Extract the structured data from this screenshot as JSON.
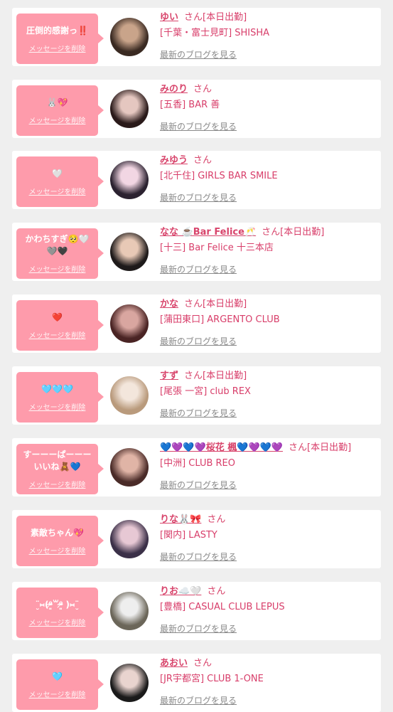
{
  "delete_label": "メッセージを削除",
  "blog_label": "最新のブログを見る",
  "honorific": "さん",
  "items": [
    {
      "message": "圧倒的感謝っ‼️",
      "name": "ゆい",
      "status": "[本日出勤]",
      "shop": "[千葉・富士見町] SHISHA",
      "avatar_colors": [
        "#3a2a22",
        "#c9a48a"
      ]
    },
    {
      "message": "🐰💖",
      "name": "みのり",
      "status": "",
      "shop": "[五香] BAR 善",
      "avatar_colors": [
        "#2a1a1a",
        "#e5c7c0"
      ]
    },
    {
      "message": "🤍",
      "name": "みゆう",
      "status": "",
      "shop": "[北千住] GIRLS BAR SMILE",
      "avatar_colors": [
        "#2b2230",
        "#f2d6e3"
      ]
    },
    {
      "message": "かわちすぎ🥺🤍🩶🖤",
      "name": "なな ☕️Bar Felice🥂",
      "status": "[本日出勤]",
      "shop": "[十三] Bar Felice 十三本店",
      "avatar_colors": [
        "#1e1a1a",
        "#e8c9b6"
      ]
    },
    {
      "message": "❤️",
      "name": "かな",
      "status": "[本日出勤]",
      "shop": "[蒲田東口] ARGENTO CLUB",
      "avatar_colors": [
        "#4a2424",
        "#d9a6a0"
      ]
    },
    {
      "message": "🩵🩵🩵",
      "name": "すず",
      "status": "[本日出勤]",
      "shop": "[尾張 一宮] club REX",
      "avatar_colors": [
        "#b99a7c",
        "#f3e6dc"
      ]
    },
    {
      "message": "すーーーぱーーーいいね🧸💙",
      "name": "💙💜💙💜桜花 楓💙💜💙💜",
      "status": "[本日出勤]",
      "shop": "[中洲] CLUB REO",
      "avatar_colors": [
        "#4a2b28",
        "#e0b4a6"
      ]
    },
    {
      "message": "素敵ちゃん💖",
      "name": "りな🐰🎀",
      "status": "",
      "shop": "[関内] LASTY",
      "avatar_colors": [
        "#3b3048",
        "#e7c8d4"
      ]
    },
    {
      "message": "¨̮⑅(⁰̷̴͈꒳⁰̷̴͈ )⑅¨̮",
      "name": "りお☁️🤍",
      "status": "",
      "shop": "[豊橋] CASUAL CLUB LEPUS",
      "avatar_colors": [
        "#6b6659",
        "#eeeeee"
      ]
    },
    {
      "message": "🩵",
      "name": "あおい",
      "status": "",
      "shop": "[JR宇都宮] CLUB 1-ONE",
      "avatar_colors": [
        "#1a1a1a",
        "#e9d4cf"
      ]
    }
  ]
}
